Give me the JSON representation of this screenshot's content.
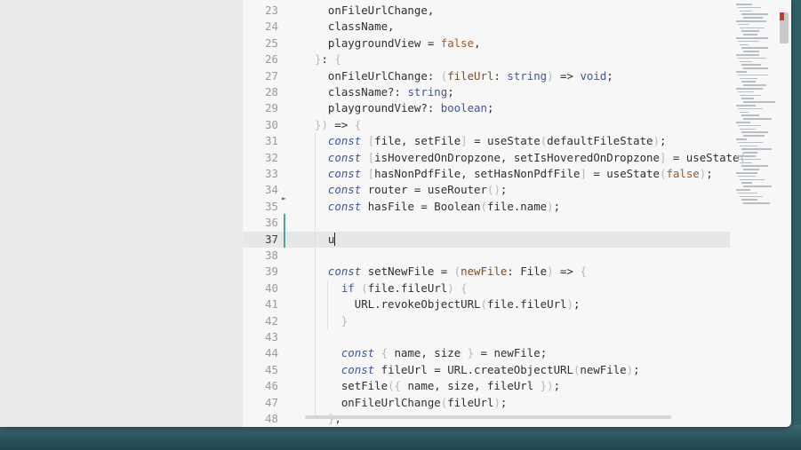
{
  "editor": {
    "lines": [
      {
        "num": "23",
        "tokens": [
          {
            "t": "  onFileUrlChange,"
          }
        ]
      },
      {
        "num": "24",
        "tokens": [
          {
            "t": "  className,"
          }
        ]
      },
      {
        "num": "25",
        "tokens": [
          {
            "t": "  playgroundView = "
          },
          {
            "t": "false",
            "c": "bool"
          },
          {
            "t": ","
          }
        ]
      },
      {
        "num": "26",
        "tokens": [
          {
            "t": "}",
            "c": "br"
          },
          {
            "t": ": "
          },
          {
            "t": "{",
            "c": "br"
          }
        ]
      },
      {
        "num": "27",
        "tokens": [
          {
            "t": "  onFileUrlChange: "
          },
          {
            "t": "(",
            "c": "br"
          },
          {
            "t": "fileUrl",
            "c": "prm"
          },
          {
            "t": ": "
          },
          {
            "t": "string",
            "c": "typ"
          },
          {
            "t": ")",
            "c": "br"
          },
          {
            "t": " => "
          },
          {
            "t": "void",
            "c": "typ"
          },
          {
            "t": ";"
          }
        ]
      },
      {
        "num": "28",
        "tokens": [
          {
            "t": "  className?: "
          },
          {
            "t": "string",
            "c": "typ"
          },
          {
            "t": ";"
          }
        ]
      },
      {
        "num": "29",
        "tokens": [
          {
            "t": "  playgroundView?: "
          },
          {
            "t": "boolean",
            "c": "typ"
          },
          {
            "t": ";"
          }
        ]
      },
      {
        "num": "30",
        "tokens": [
          {
            "t": "}",
            "c": "br"
          },
          {
            "t": ")",
            "c": "br"
          },
          {
            "t": " => "
          },
          {
            "t": "{",
            "c": "br"
          }
        ]
      },
      {
        "num": "31",
        "tokens": [
          {
            "t": "  "
          },
          {
            "t": "const",
            "c": "kw"
          },
          {
            "t": " "
          },
          {
            "t": "[",
            "c": "br"
          },
          {
            "t": "file, setFile"
          },
          {
            "t": "]",
            "c": "br"
          },
          {
            "t": " = useState"
          },
          {
            "t": "(",
            "c": "br"
          },
          {
            "t": "defaultFileState"
          },
          {
            "t": ")",
            "c": "br"
          },
          {
            "t": ";"
          }
        ]
      },
      {
        "num": "32",
        "tokens": [
          {
            "t": "  "
          },
          {
            "t": "const",
            "c": "kw"
          },
          {
            "t": " "
          },
          {
            "t": "[",
            "c": "br"
          },
          {
            "t": "isHoveredOnDropzone, setIsHoveredOnDropzone"
          },
          {
            "t": "]",
            "c": "br"
          },
          {
            "t": " = useState"
          },
          {
            "t": "(",
            "c": "br"
          }
        ]
      },
      {
        "num": "33",
        "tokens": [
          {
            "t": "  "
          },
          {
            "t": "const",
            "c": "kw"
          },
          {
            "t": " "
          },
          {
            "t": "[",
            "c": "br"
          },
          {
            "t": "hasNonPdfFile, setHasNonPdfFile"
          },
          {
            "t": "]",
            "c": "br"
          },
          {
            "t": " = useState"
          },
          {
            "t": "(",
            "c": "br"
          },
          {
            "t": "false",
            "c": "bool"
          },
          {
            "t": ")",
            "c": "br"
          },
          {
            "t": ";"
          }
        ]
      },
      {
        "num": "34",
        "tokens": [
          {
            "t": "  "
          },
          {
            "t": "const",
            "c": "kw"
          },
          {
            "t": " router = useRouter"
          },
          {
            "t": "()",
            "c": "br"
          },
          {
            "t": ";"
          }
        ]
      },
      {
        "num": "35",
        "tokens": [
          {
            "t": "  "
          },
          {
            "t": "const",
            "c": "kw"
          },
          {
            "t": " hasFile = Boolean"
          },
          {
            "t": "(",
            "c": "br"
          },
          {
            "t": "file.name"
          },
          {
            "t": ")",
            "c": "br"
          },
          {
            "t": ";"
          }
        ]
      },
      {
        "num": "36",
        "tokens": []
      },
      {
        "num": "37",
        "tokens": [
          {
            "t": "  u"
          }
        ],
        "current": true
      },
      {
        "num": "38",
        "tokens": []
      },
      {
        "num": "39",
        "tokens": [
          {
            "t": "  "
          },
          {
            "t": "const",
            "c": "kw"
          },
          {
            "t": " setNewFile = "
          },
          {
            "t": "(",
            "c": "br"
          },
          {
            "t": "newFile",
            "c": "prm"
          },
          {
            "t": ": File"
          },
          {
            "t": ")",
            "c": "br"
          },
          {
            "t": " => "
          },
          {
            "t": "{",
            "c": "br"
          }
        ]
      },
      {
        "num": "40",
        "tokens": [
          {
            "t": "    "
          },
          {
            "t": "if",
            "c": "typ"
          },
          {
            "t": " "
          },
          {
            "t": "(",
            "c": "br"
          },
          {
            "t": "file.fileUrl"
          },
          {
            "t": ")",
            "c": "br"
          },
          {
            "t": " "
          },
          {
            "t": "{",
            "c": "br"
          }
        ]
      },
      {
        "num": "41",
        "tokens": [
          {
            "t": "      URL.revokeObjectURL"
          },
          {
            "t": "(",
            "c": "br"
          },
          {
            "t": "file.fileUrl"
          },
          {
            "t": ")",
            "c": "br"
          },
          {
            "t": ";"
          }
        ]
      },
      {
        "num": "42",
        "tokens": [
          {
            "t": "    "
          },
          {
            "t": "}",
            "c": "br"
          }
        ]
      },
      {
        "num": "43",
        "tokens": []
      },
      {
        "num": "44",
        "tokens": [
          {
            "t": "    "
          },
          {
            "t": "const",
            "c": "kw"
          },
          {
            "t": " "
          },
          {
            "t": "{",
            "c": "br"
          },
          {
            "t": " name, size "
          },
          {
            "t": "}",
            "c": "br"
          },
          {
            "t": " = newFile;"
          }
        ]
      },
      {
        "num": "45",
        "tokens": [
          {
            "t": "    "
          },
          {
            "t": "const",
            "c": "kw"
          },
          {
            "t": " fileUrl = URL.createObjectURL"
          },
          {
            "t": "(",
            "c": "br"
          },
          {
            "t": "newFile"
          },
          {
            "t": ")",
            "c": "br"
          },
          {
            "t": ";"
          }
        ]
      },
      {
        "num": "46",
        "tokens": [
          {
            "t": "    setFile"
          },
          {
            "t": "(",
            "c": "br"
          },
          {
            "t": "{",
            "c": "br"
          },
          {
            "t": " name, size, fileUrl "
          },
          {
            "t": "}",
            "c": "br"
          },
          {
            "t": ")",
            "c": "br"
          },
          {
            "t": ";"
          }
        ]
      },
      {
        "num": "47",
        "tokens": [
          {
            "t": "    onFileUrlChange"
          },
          {
            "t": "(",
            "c": "br"
          },
          {
            "t": "fileUrl"
          },
          {
            "t": ")",
            "c": "br"
          },
          {
            "t": ";"
          }
        ]
      },
      {
        "num": "48",
        "tokens": [
          {
            "t": "  "
          },
          {
            "t": "}",
            "c": "br"
          },
          {
            "t": ";"
          }
        ]
      }
    ]
  },
  "colors": {
    "keyword": "#3d55a3",
    "boolean": "#9c5a26",
    "param": "#7a4e1a",
    "bracket": "#b8b8b8",
    "change_indicator": "#4aa69a",
    "scroll_marker": "#c23b3b"
  }
}
